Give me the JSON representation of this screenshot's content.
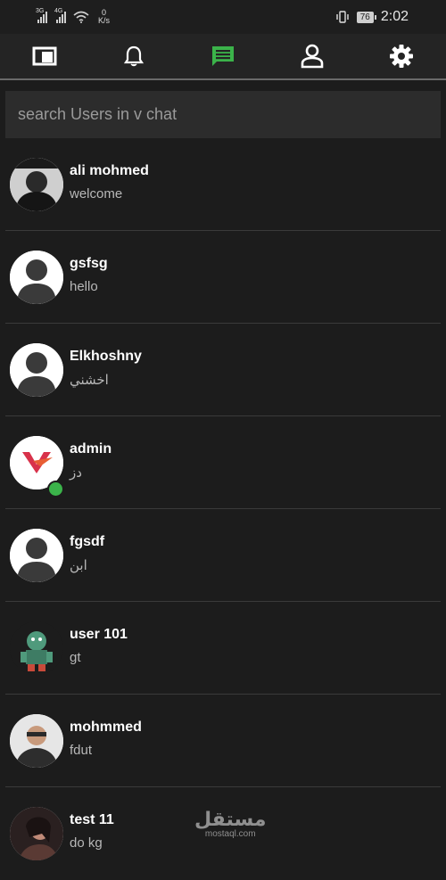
{
  "status_bar": {
    "net1": "3G",
    "net2": "4G",
    "speed_value": "0",
    "speed_unit": "K/s",
    "battery": "76",
    "time": "2:02"
  },
  "nav": {
    "tabs": [
      {
        "name": "feed",
        "icon": "window-icon",
        "active": false
      },
      {
        "name": "notifications",
        "icon": "bell-icon",
        "active": false
      },
      {
        "name": "chats",
        "icon": "chat-icon",
        "active": true
      },
      {
        "name": "profile",
        "icon": "person-icon",
        "active": false
      },
      {
        "name": "settings",
        "icon": "gear-icon",
        "active": false
      }
    ],
    "active_color": "#3bb34a",
    "icon_color": "#ffffff"
  },
  "search": {
    "placeholder": "search Users in v chat",
    "value": ""
  },
  "conversations": [
    {
      "name": "ali mohmed",
      "message": "welcome",
      "avatar": "photo",
      "online": false
    },
    {
      "name": "gsfsg",
      "message": "hello",
      "avatar": "default",
      "online": false
    },
    {
      "name": "Elkhoshny",
      "message": "اخشني",
      "avatar": "default",
      "online": false
    },
    {
      "name": "admin",
      "message": "دز",
      "avatar": "logo-v",
      "online": true
    },
    {
      "name": "fgsdf",
      "message": "ابن",
      "avatar": "default",
      "online": false
    },
    {
      "name": "user 101",
      "message": "gt",
      "avatar": "cartoon",
      "online": false
    },
    {
      "name": "mohmmed",
      "message": "fdut",
      "avatar": "photo",
      "online": false
    },
    {
      "name": "test 11",
      "message": "do kg",
      "avatar": "photo",
      "online": false
    }
  ],
  "watermark": {
    "arabic": "مستقل",
    "latin": "mostaql.com"
  }
}
